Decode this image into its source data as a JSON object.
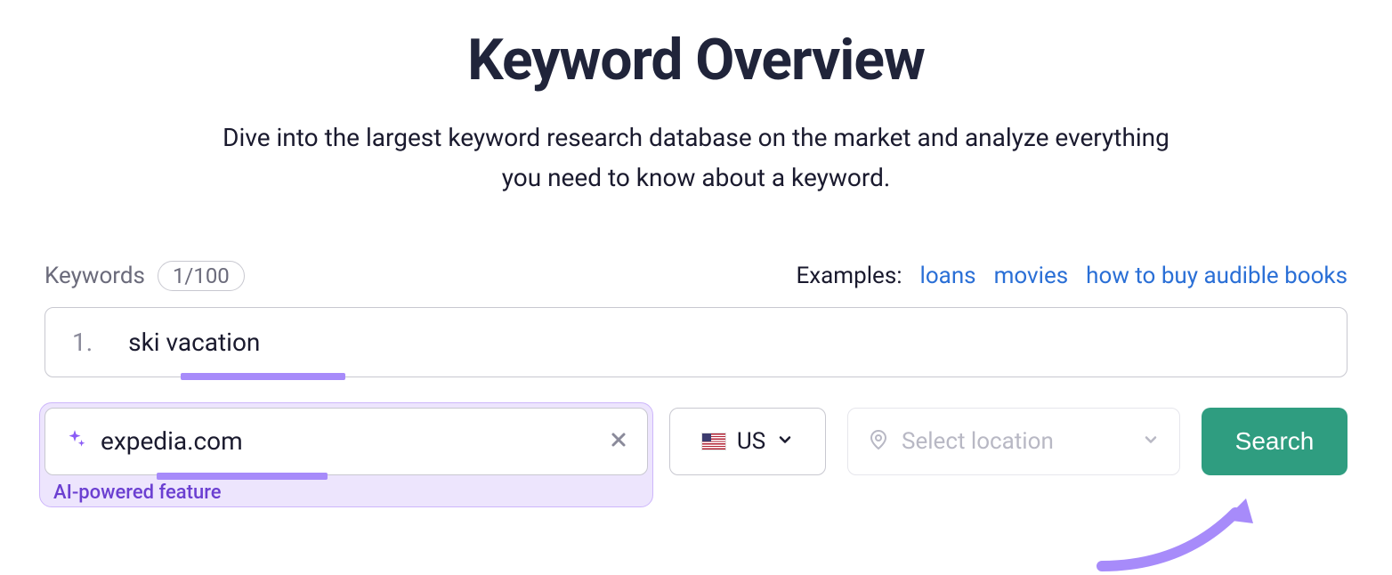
{
  "title": "Keyword Overview",
  "subtitle": "Dive into the largest keyword research database on the market and analyze everything you need to know about a keyword.",
  "keywords_label": "Keywords",
  "keywords_count": "1/100",
  "examples_label": "Examples:",
  "examples": [
    "loans",
    "movies",
    "how to buy audible books"
  ],
  "keyword_row": {
    "index": "1.",
    "value": "ski vacation"
  },
  "domain": {
    "value": "expedia.com",
    "ai_label": "AI-powered feature"
  },
  "country": {
    "code": "US"
  },
  "location": {
    "placeholder": "Select location"
  },
  "search_label": "Search"
}
